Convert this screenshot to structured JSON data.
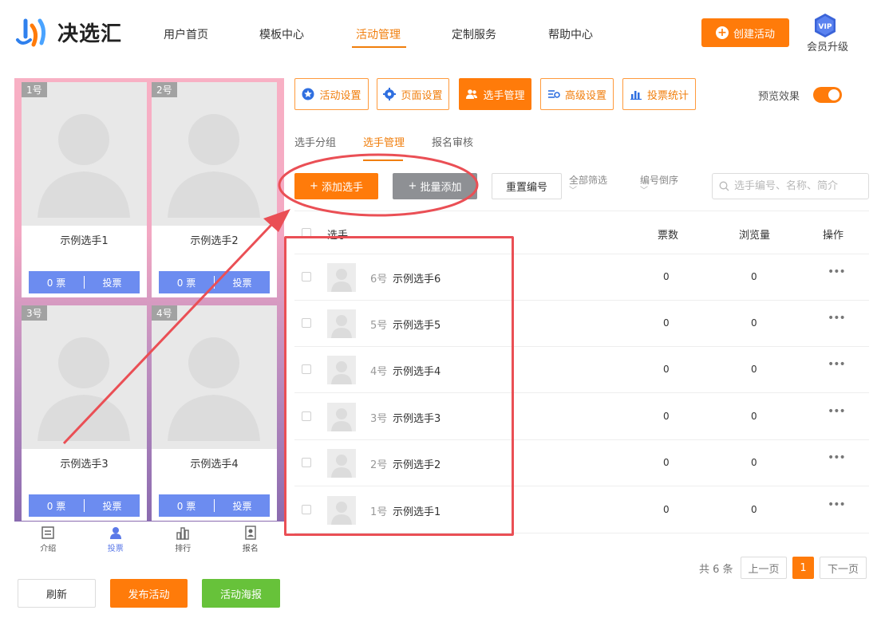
{
  "header": {
    "logo_text": "决选汇",
    "nav": [
      "用户首页",
      "模板中心",
      "活动管理",
      "定制服务",
      "帮助中心"
    ],
    "active_nav_index": 2,
    "create_button": "创建活动",
    "vip_badge": "VIP",
    "vip_label": "会员升级"
  },
  "preview": {
    "cards": [
      {
        "num": "1号",
        "name": "示例选手1",
        "votes": "0 票",
        "vote_btn": "投票"
      },
      {
        "num": "2号",
        "name": "示例选手2",
        "votes": "0 票",
        "vote_btn": "投票"
      },
      {
        "num": "3号",
        "name": "示例选手3",
        "votes": "0 票",
        "vote_btn": "投票"
      },
      {
        "num": "4号",
        "name": "示例选手4",
        "votes": "0 票",
        "vote_btn": "投票"
      }
    ],
    "tabs": [
      {
        "label": "介绍",
        "icon": "intro-icon"
      },
      {
        "label": "投票",
        "icon": "user-icon"
      },
      {
        "label": "排行",
        "icon": "ranking-icon"
      },
      {
        "label": "报名",
        "icon": "signup-icon"
      }
    ],
    "active_tab_index": 1
  },
  "bottom_buttons": {
    "refresh": "刷新",
    "publish": "发布活动",
    "poster": "活动海报"
  },
  "toolbar": {
    "items": [
      {
        "label": "活动设置",
        "icon": "star-icon"
      },
      {
        "label": "页面设置",
        "icon": "gear-icon"
      },
      {
        "label": "选手管理",
        "icon": "users-icon"
      },
      {
        "label": "高级设置",
        "icon": "settings-sliders-icon"
      },
      {
        "label": "投票统计",
        "icon": "bar-chart-icon"
      }
    ],
    "active_index": 2,
    "preview_label": "预览效果",
    "preview_on": true
  },
  "subtabs": {
    "items": [
      "选手分组",
      "选手管理",
      "报名审核"
    ],
    "active_index": 1
  },
  "actions": {
    "add": "添加选手",
    "batch_add": "批量添加",
    "reset_number": "重置编号",
    "filter_all": "全部筛选",
    "sort_number_desc": "编号倒序",
    "search_placeholder": "选手编号、名称、简介"
  },
  "table": {
    "headers": {
      "player": "选手",
      "votes": "票数",
      "views": "浏览量",
      "ops": "操作"
    },
    "rows": [
      {
        "num": "6号",
        "name": "示例选手6",
        "votes": "0",
        "views": "0",
        "ops": "•••"
      },
      {
        "num": "5号",
        "name": "示例选手5",
        "votes": "0",
        "views": "0",
        "ops": "•••"
      },
      {
        "num": "4号",
        "name": "示例选手4",
        "votes": "0",
        "views": "0",
        "ops": "•••"
      },
      {
        "num": "3号",
        "name": "示例选手3",
        "votes": "0",
        "views": "0",
        "ops": "•••"
      },
      {
        "num": "2号",
        "name": "示例选手2",
        "votes": "0",
        "views": "0",
        "ops": "•••"
      },
      {
        "num": "1号",
        "name": "示例选手1",
        "votes": "0",
        "views": "0",
        "ops": "•••"
      }
    ]
  },
  "pagination": {
    "total": "共 6 条",
    "prev": "上一页",
    "current": "1",
    "next": "下一页"
  },
  "colors": {
    "accent": "#ff7b0a",
    "vote_blue": "#6c8cf0",
    "annotation_red": "#ea4f55",
    "poster_green": "#67c23a"
  }
}
